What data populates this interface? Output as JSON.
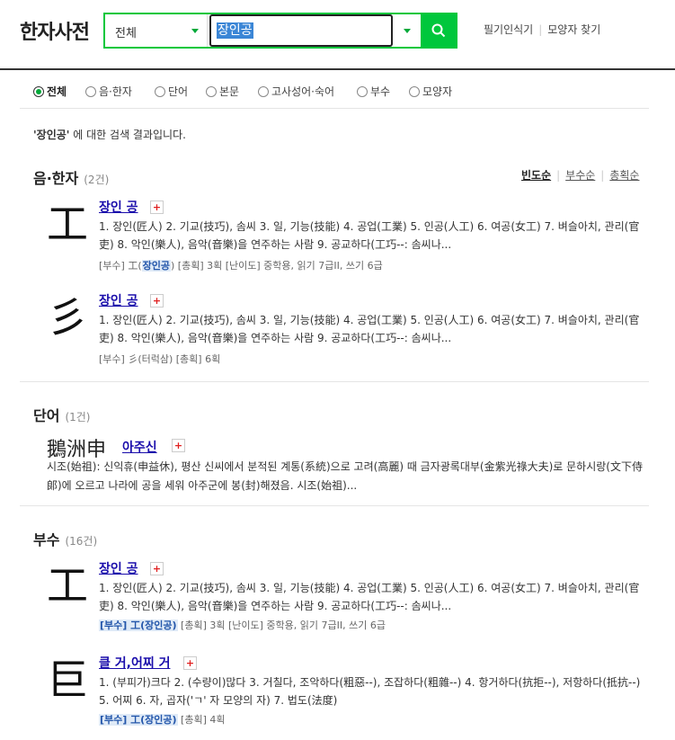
{
  "header": {
    "logo": "한자사전",
    "scope": "전체",
    "query": "장인공",
    "links": [
      "필기인식기",
      "모양자 찾기"
    ]
  },
  "filters": [
    "전체",
    "음·한자",
    "단어",
    "본문",
    "고사성어·숙어",
    "부수",
    "모양자"
  ],
  "result_msg": {
    "query_quoted": "'장인공'",
    "suffix": " 에 대한 검색 결과입니다."
  },
  "sections": {
    "hanja": {
      "title": "음·한자",
      "count": "(2건)"
    },
    "word": {
      "title": "단어",
      "count": "(1건)"
    },
    "radical": {
      "title": "부수",
      "count": "(16건)"
    }
  },
  "sort": [
    "빈도순",
    "부수순",
    "총획순"
  ],
  "hanja_entries": [
    {
      "char": "工",
      "title": "장인 공",
      "desc": "1. 장인(匠人) 2. 기교(技巧), 솜씨 3. 일, 기능(技能) 4. 공업(工業) 5. 인공(人工) 6. 여공(女工) 7. 벼슬아치, 관리(官吏) 8. 악인(樂人), 음악(音樂)을 연주하는 사람 9. 공교하다(工巧--: 솜씨나...",
      "meta_pre": "[부수] 工(",
      "meta_hl": "장인공",
      "meta_post": ") [총획] 3획 [난이도] 중학용, 읽기 7급II, 쓰기 6급"
    },
    {
      "char": "彡",
      "title": "장인 공",
      "desc": "1. 장인(匠人) 2. 기교(技巧), 솜씨 3. 일, 기능(技能) 4. 공업(工業) 5. 인공(人工) 6. 여공(女工) 7. 벼슬아치, 관리(官吏) 8. 악인(樂人), 음악(音樂)을 연주하는 사람 9. 공교하다(工巧--: 솜씨나...",
      "meta": "[부수] 彡(터럭삼) [총획] 6획"
    }
  ],
  "word_entry": {
    "chars": "鵝洲申",
    "title": "아주신",
    "desc": "시조(始祖): 신익휴(申益休), 평산 신씨에서 분적된 계통(系統)으로 고려(高麗) 때 금자광록대부(金紫光祿大夫)로 문하시랑(文下侍郞)에 오르고 나라에 공을 세워 아주군에 봉(封)해졌음. 시조(始祖)..."
  },
  "radical_entries": [
    {
      "char": "工",
      "title": "장인 공",
      "desc": "1. 장인(匠人) 2. 기교(技巧), 솜씨 3. 일, 기능(技能) 4. 공업(工業) 5. 인공(人工) 6. 여공(女工) 7. 벼슬아치, 관리(官吏) 8. 악인(樂人), 음악(音樂)을 연주하는 사람 9. 공교하다(工巧--: 솜씨나...",
      "meta_hl": "[부수] 工(장인공)",
      "meta_post": " [총획] 3획 [난이도] 중학용, 읽기 7급II, 쓰기 6급"
    },
    {
      "char": "巨",
      "title": "클 거,어찌 거",
      "desc": "1. (부피가)크다 2. (수량이)많다 3. 거칠다, 조악하다(粗惡--), 조잡하다(粗雜--) 4. 항거하다(抗拒--), 저항하다(抵抗--) 5. 어찌 6. 자, 곱자('ㄱ' 자 모양의 자) 7. 법도(法度)",
      "meta_hl": "[부수] 工(장인공)",
      "meta_post": " [총획] 4획"
    }
  ]
}
